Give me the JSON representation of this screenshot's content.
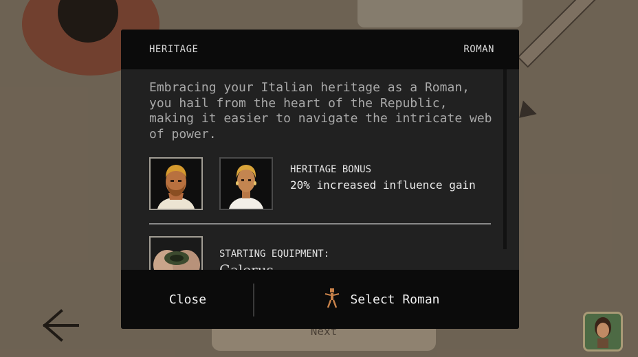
{
  "modal": {
    "header_left": "HERITAGE",
    "header_right": "ROMAN",
    "description": "Embracing your Italian heritage as a Roman, you hail from the heart of the Republic, making it easier to navigate the intricate web of power.",
    "bonus": {
      "title": "HERITAGE BONUS",
      "text": "20% increased influence gain"
    },
    "equipment": {
      "title": "STARTING EQUIPMENT:",
      "item": "Galerus"
    },
    "footer": {
      "close_label": "Close",
      "select_label": "Select Roman",
      "select_icon": "figure-icon"
    }
  },
  "background": {
    "next_label": "Next",
    "back_icon": "back-arrow-icon",
    "avatar_icon": "character-avatar-icon"
  },
  "colors": {
    "modal_bg": "#212121",
    "header_bg": "#0b0b0b",
    "figure_icon": "#c8824a"
  }
}
